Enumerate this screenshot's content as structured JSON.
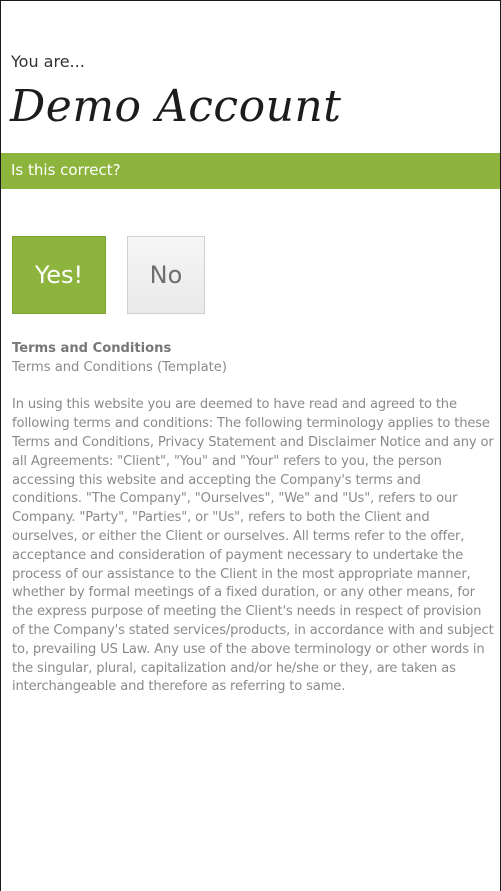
{
  "header": {
    "prefix": "You are...",
    "account_name": "Demo Account"
  },
  "confirm": {
    "question": "Is this correct?",
    "yes_label": "Yes!",
    "no_label": "No"
  },
  "terms": {
    "title": "Terms and Conditions",
    "subtitle": "Terms and Conditions (Template)",
    "body": "In using this website you are deemed to have read and agreed to the following terms and conditions: The following terminology applies to these Terms and Conditions, Privacy Statement and Disclaimer Notice and any or all Agreements: \"Client\", \"You\" and \"Your\" refers to you, the person accessing this website and accepting the Company's terms and conditions. \"The Company\", \"Ourselves\", \"We\" and \"Us\", refers to our Company. \"Party\", \"Parties\", or \"Us\", refers to both the Client and ourselves, or either the Client or ourselves. All terms refer to the offer, acceptance and consideration of payment necessary to undertake the process of our assistance to the Client in the most appropriate manner, whether by formal meetings of a fixed duration, or any other means, for the express purpose of meeting the Client's needs in respect of provision of the Company's stated services/products, in accordance with and subject to, prevailing US Law. Any use of the above terminology or other words in the singular, plural, capitalization and/or he/she or they, are taken as interchangeable and therefore as referring to same."
  },
  "colors": {
    "accent": "#8db43c",
    "button_neutral": "#eeeeee",
    "body_text": "#8a8a8a"
  }
}
